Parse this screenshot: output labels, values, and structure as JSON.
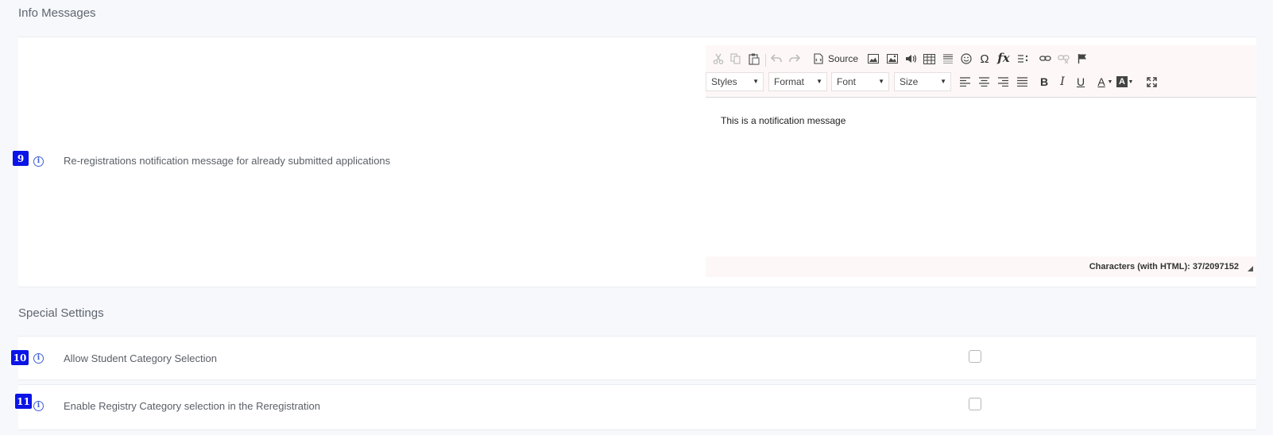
{
  "sections": {
    "info_messages": "Info Messages",
    "special_settings": "Special Settings"
  },
  "rows": {
    "row9": {
      "number": "9",
      "label": "Re-registrations notification message for already submitted applications"
    },
    "row10": {
      "number": "10",
      "label": "Allow Student Category Selection",
      "checked": false
    },
    "row11": {
      "number": "11",
      "label": "Enable Registry Category selection in the Reregistration",
      "checked": false
    }
  },
  "editor": {
    "source_label": "Source",
    "combos": {
      "styles": "Styles",
      "format": "Format",
      "font": "Font",
      "size": "Size"
    },
    "glyphs": {
      "omega": "Ω",
      "fx": "fx",
      "bold": "B",
      "italic": "I",
      "underline": "U",
      "text_color": "A",
      "bg_color": "A"
    },
    "content": "This is a notification message",
    "counter": "Characters (with HTML): 37/2097152"
  },
  "icons": [
    "cut-icon",
    "copy-icon",
    "paste-icon",
    "undo-icon",
    "redo-icon",
    "source-icon",
    "image-icon",
    "image2-icon",
    "audio-icon",
    "table-icon",
    "horizontal-line-icon",
    "smiley-icon",
    "special-char-icon",
    "math-icon",
    "list-icon",
    "link-icon",
    "unlink-icon",
    "anchor-icon",
    "align-left-icon",
    "align-center-icon",
    "align-right-icon",
    "justify-icon",
    "bold-icon",
    "italic-icon",
    "underline-icon",
    "text-color-icon",
    "bg-color-icon",
    "maximize-icon",
    "info-icon",
    "checkbox"
  ],
  "colors": {
    "badge": "#0b14e6",
    "info": "#3d5fd6",
    "toolbar_bg": "#fdf8f7",
    "page_bg": "#f7f8fb"
  }
}
